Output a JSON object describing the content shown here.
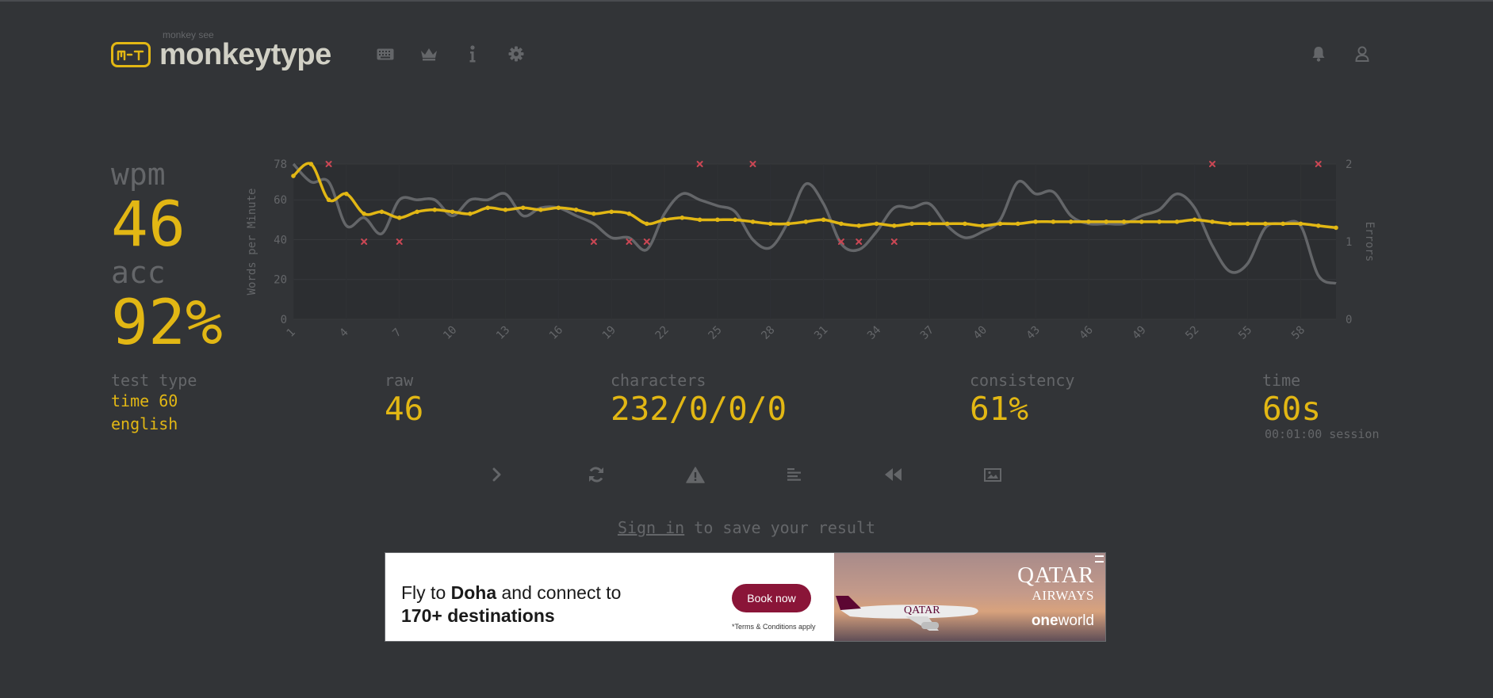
{
  "header": {
    "logo_sub": "monkey see",
    "logo_text": "monkeytype",
    "nav_icons": [
      "keyboard-icon",
      "crown-icon",
      "info-icon",
      "gear-icon"
    ],
    "right_icons": [
      "bell-icon",
      "user-icon"
    ]
  },
  "stats": {
    "wpm_label": "wpm",
    "wpm_value": "46",
    "acc_label": "acc",
    "acc_value": "92%",
    "test_type_label": "test type",
    "test_type_mode": "time 60",
    "test_type_language": "english",
    "raw_label": "raw",
    "raw_value": "46",
    "characters_label": "characters",
    "characters_value": "232/0/0/0",
    "consistency_label": "consistency",
    "consistency_value": "61%",
    "time_label": "time",
    "time_value": "60s",
    "time_session": "00:01:00 session"
  },
  "actions": [
    "next-test-icon",
    "restart-icon",
    "report-icon",
    "words-history-icon",
    "replay-icon",
    "screenshot-icon"
  ],
  "signin": {
    "link": "Sign in",
    "text": " to save your result"
  },
  "ad": {
    "line1_pre": "Fly to ",
    "line1_bold": "Doha",
    "line1_post": " and connect to",
    "line2": "170+ destinations",
    "button": "Book now",
    "terms": "*Terms & Conditions apply",
    "brand1": "QATAR",
    "brand2": "AIRWAYS",
    "plane_text": "QATAR",
    "ow1": "one",
    "ow2": "world"
  },
  "colors": {
    "background": "#323437",
    "main": "#e2b714",
    "sub": "#646669",
    "text": "#d1d0c5",
    "error": "#ca4754"
  },
  "chart_data": {
    "type": "line",
    "ylabel": "Words per Minute",
    "y2label": "Errors",
    "ylim": [
      0,
      78
    ],
    "y2lim": [
      0,
      2
    ],
    "yticks": [
      0,
      20,
      40,
      60,
      78
    ],
    "y2ticks": [
      0,
      1,
      2
    ],
    "xticks": [
      1,
      4,
      7,
      10,
      13,
      16,
      19,
      22,
      25,
      28,
      31,
      34,
      37,
      40,
      43,
      46,
      49,
      52,
      55,
      58
    ],
    "x": [
      1,
      2,
      3,
      4,
      5,
      6,
      7,
      8,
      9,
      10,
      11,
      12,
      13,
      14,
      15,
      16,
      17,
      18,
      19,
      20,
      21,
      22,
      23,
      24,
      25,
      26,
      27,
      28,
      29,
      30,
      31,
      32,
      33,
      34,
      35,
      36,
      37,
      38,
      39,
      40,
      41,
      42,
      43,
      44,
      45,
      46,
      47,
      48,
      49,
      50,
      51,
      52,
      53,
      54,
      55,
      56,
      57,
      58,
      59,
      60
    ],
    "series": [
      {
        "name": "wpm",
        "color": "#e2b714",
        "values": [
          72,
          78,
          60,
          63,
          53,
          54,
          51,
          54,
          55,
          54,
          53,
          56,
          55,
          56,
          55,
          56,
          55,
          53,
          54,
          53,
          48,
          50,
          51,
          50,
          50,
          50,
          49,
          48,
          48,
          49,
          50,
          48,
          47,
          48,
          47,
          48,
          48,
          48,
          48,
          47,
          48,
          48,
          49,
          49,
          49,
          49,
          49,
          49,
          49,
          49,
          49,
          50,
          49,
          48,
          48,
          48,
          48,
          48,
          47,
          46
        ]
      },
      {
        "name": "raw",
        "color": "#646669",
        "values": [
          78,
          69,
          69,
          47,
          51,
          43,
          60,
          60,
          60,
          52,
          60,
          60,
          63,
          52,
          56,
          56,
          52,
          48,
          41,
          41,
          35,
          53,
          63,
          60,
          57,
          54,
          40,
          36,
          49,
          68,
          58,
          38,
          35,
          44,
          56,
          56,
          58,
          47,
          41,
          44,
          50,
          69,
          63,
          64,
          52,
          48,
          48,
          48,
          52,
          55,
          63,
          56,
          37,
          24,
          28,
          46,
          48,
          47,
          22,
          18
        ]
      }
    ],
    "errors": [
      {
        "x": 3,
        "y": 2
      },
      {
        "x": 5,
        "y": 1
      },
      {
        "x": 7,
        "y": 1
      },
      {
        "x": 18,
        "y": 1
      },
      {
        "x": 20,
        "y": 1
      },
      {
        "x": 21,
        "y": 1
      },
      {
        "x": 24,
        "y": 2
      },
      {
        "x": 27,
        "y": 2
      },
      {
        "x": 32,
        "y": 1
      },
      {
        "x": 33,
        "y": 1
      },
      {
        "x": 35,
        "y": 1
      },
      {
        "x": 53,
        "y": 2
      },
      {
        "x": 59,
        "y": 2
      }
    ]
  }
}
